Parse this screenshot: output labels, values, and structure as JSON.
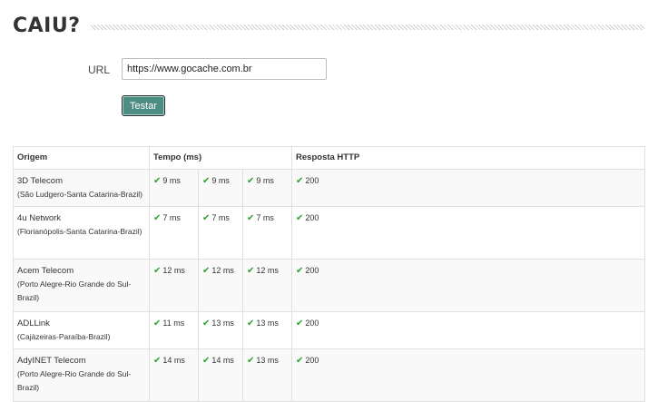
{
  "header": {
    "title": "CAIU?"
  },
  "form": {
    "url_label": "URL",
    "url_value": "https://www.gocache.com.br",
    "test_label": "Testar"
  },
  "table": {
    "columns": [
      "Origem",
      "Tempo (ms)",
      "Resposta HTTP"
    ],
    "rows": [
      {
        "name": "3D Telecom",
        "location": "(São Ludgero-Santa Catarina-Brazil)",
        "times": [
          "9 ms",
          "9 ms",
          "9 ms"
        ],
        "status": "200"
      },
      {
        "name": "4u Network",
        "location": "(Florianópolis-Santa Catarina-Brazil)",
        "times": [
          "7 ms",
          "7 ms",
          "7 ms"
        ],
        "status": "200"
      },
      {
        "name": "Acem Telecom",
        "location": "(Porto Alegre-Rio Grande do Sul-Brazil)",
        "times": [
          "12 ms",
          "12 ms",
          "12 ms"
        ],
        "status": "200"
      },
      {
        "name": "ADLLink",
        "location": "(Cajàzeiras-Paraíba-Brazil)",
        "times": [
          "11 ms",
          "13 ms",
          "13 ms"
        ],
        "status": "200"
      },
      {
        "name": "AdyINET Telecom",
        "location": "(Porto Alegre-Rio Grande do Sul-Brazil)",
        "times": [
          "14 ms",
          "14 ms",
          "13 ms"
        ],
        "status": "200"
      }
    ]
  },
  "icons": {
    "success": "check-icon",
    "success_color": "#2ea02e"
  }
}
